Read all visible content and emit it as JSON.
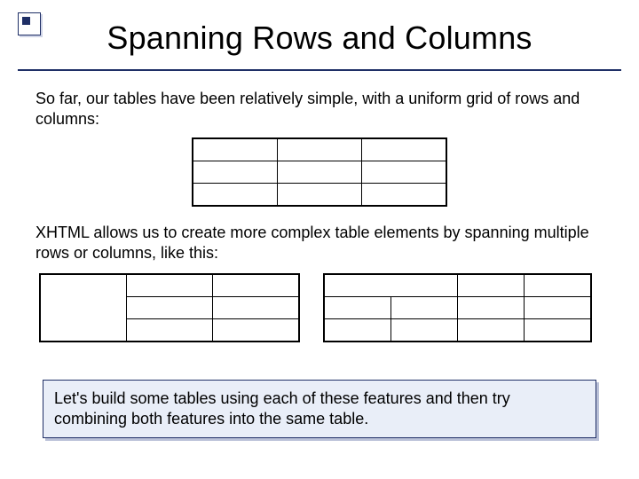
{
  "title": "Spanning Rows and Columns",
  "para1": "So far, our tables have been relatively simple, with a uniform grid of rows and columns:",
  "para2": "XHTML allows us to create more complex table elements by spanning multiple rows or columns, like this:",
  "callout": "Let's build some tables using each of these features and then try combining both features into the same table."
}
